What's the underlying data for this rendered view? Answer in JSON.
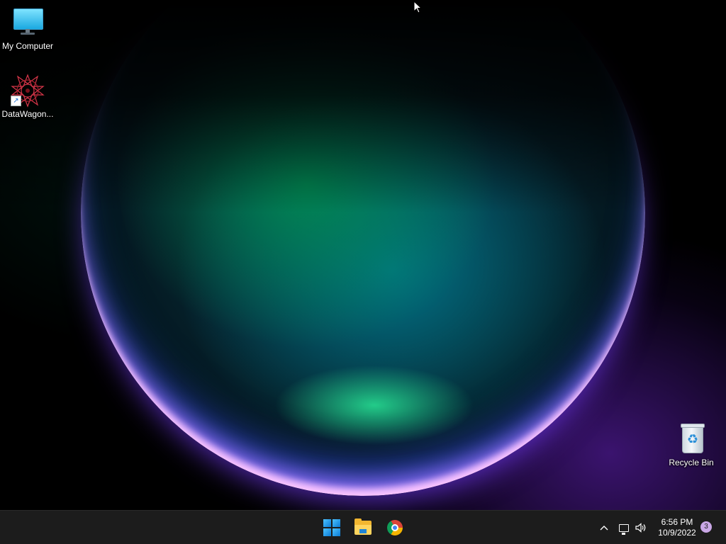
{
  "desktop": {
    "icons": [
      {
        "label": "My Computer",
        "icon": "monitor-icon"
      },
      {
        "label": "DataWagon...",
        "icon": "datawagon-app-icon"
      },
      {
        "label": "Recycle Bin",
        "icon": "recycle-bin-icon"
      }
    ]
  },
  "taskbar": {
    "pinned": [
      {
        "name": "Start",
        "icon": "windows-logo-icon"
      },
      {
        "name": "File Explorer",
        "icon": "folder-icon"
      },
      {
        "name": "Google Chrome",
        "icon": "chrome-icon"
      }
    ],
    "tray": {
      "chevron_glyph": "^",
      "volume_glyph": "🔊",
      "time": "6:56 PM",
      "date": "10/9/2022",
      "notification_count": "3"
    }
  },
  "colors": {
    "taskbar_bg": "#1c1c1c",
    "accent": "#4cc2ff",
    "badge": "#c9a7e6"
  }
}
